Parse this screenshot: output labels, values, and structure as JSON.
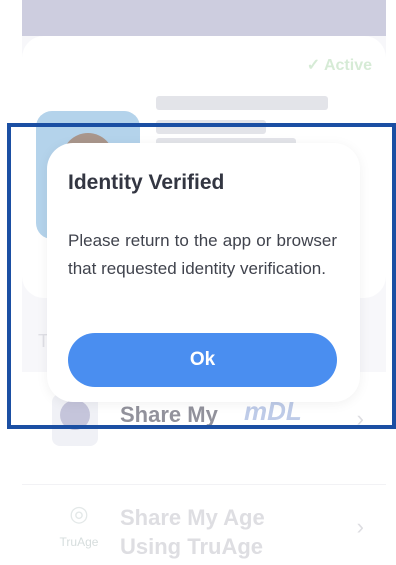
{
  "background_card": {
    "status_badge": "✓ Active"
  },
  "list": {
    "section_letter": "T",
    "mdl_row": {
      "title": "Share My",
      "logo_text": "mDL"
    },
    "age_row": {
      "title_line1": "Share My Age",
      "title_line2": "Using TruAge",
      "logo_text": "TruAge"
    },
    "chevron": "›"
  },
  "dialog": {
    "title": "Identity Verified",
    "message": "Please return to the app or browser that requested identity verification.",
    "ok_label": "Ok"
  },
  "colors": {
    "accent": "#4a8ef0",
    "highlight_frame": "#1b4fa3",
    "status_active": "#b9dcb8"
  }
}
